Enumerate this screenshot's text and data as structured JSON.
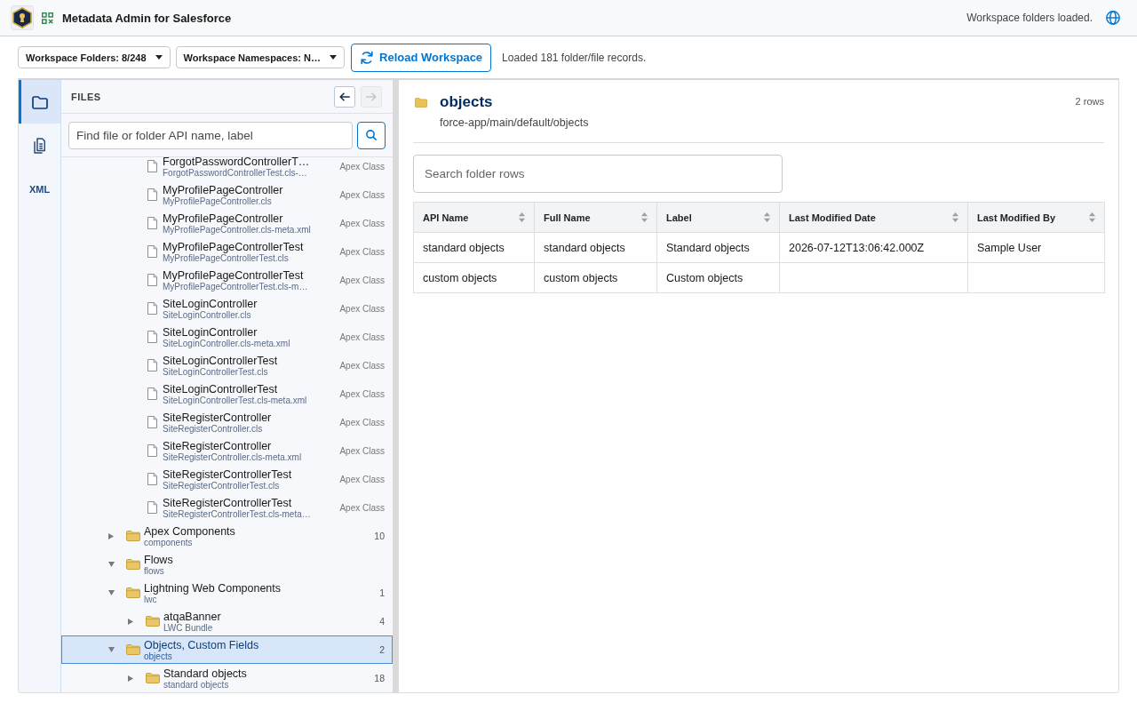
{
  "header": {
    "title": "Metadata Admin for Salesforce",
    "status": "Workspace folders loaded."
  },
  "toolbar": {
    "dropdowns": [
      {
        "label": "Workspace Folders: 8/248"
      },
      {
        "label": "Workspace Namespaces: N…"
      }
    ],
    "reload_button": {
      "label": "Reload Workspace"
    },
    "message": "Loaded 181 folder/file records."
  },
  "rail": {
    "tabs": [
      {
        "kind": "folder",
        "selected": true
      },
      {
        "kind": "document",
        "selected": false
      },
      {
        "kind": "text",
        "label": "XML",
        "selected": false
      }
    ]
  },
  "files_panel": {
    "title": "FILES",
    "nav_buttons": [
      {
        "kind": "back",
        "disabled": false
      },
      {
        "kind": "forward",
        "disabled": true
      }
    ],
    "search": {
      "placeholder": "Find file or folder API name, label"
    },
    "tree": [
      {
        "children": [
          {
            "kind": "file",
            "label": "ForgotPasswordControllerT…",
            "subtitle": "ForgotPasswordControllerTest.cls-…",
            "type": "Apex Class",
            "selected": false
          },
          {
            "kind": "file",
            "label": "MyProfilePageController",
            "subtitle": "MyProfilePageController.cls",
            "type": "Apex Class",
            "selected": false
          },
          {
            "kind": "file",
            "label": "MyProfilePageController",
            "subtitle": "MyProfilePageController.cls-meta.xml",
            "type": "Apex Class",
            "selected": false
          },
          {
            "kind": "file",
            "label": "MyProfilePageControllerTest",
            "subtitle": "MyProfilePageControllerTest.cls",
            "type": "Apex Class",
            "selected": false
          },
          {
            "kind": "file",
            "label": "MyProfilePageControllerTest",
            "subtitle": "MyProfilePageControllerTest.cls-m…",
            "type": "Apex Class",
            "selected": false
          },
          {
            "kind": "file",
            "label": "SiteLoginController",
            "subtitle": "SiteLoginController.cls",
            "type": "Apex Class",
            "selected": false
          },
          {
            "kind": "file",
            "label": "SiteLoginController",
            "subtitle": "SiteLoginController.cls-meta.xml",
            "type": "Apex Class",
            "selected": false
          },
          {
            "kind": "file",
            "label": "SiteLoginControllerTest",
            "subtitle": "SiteLoginControllerTest.cls",
            "type": "Apex Class",
            "selected": false
          },
          {
            "kind": "file",
            "label": "SiteLoginControllerTest",
            "subtitle": "SiteLoginControllerTest.cls-meta.xml",
            "type": "Apex Class",
            "selected": false
          },
          {
            "kind": "file",
            "label": "SiteRegisterController",
            "subtitle": "SiteRegisterController.cls",
            "type": "Apex Class",
            "selected": false
          },
          {
            "kind": "file",
            "label": "SiteRegisterController",
            "subtitle": "SiteRegisterController.cls-meta.xml",
            "type": "Apex Class",
            "selected": false
          },
          {
            "kind": "file",
            "label": "SiteRegisterControllerTest",
            "subtitle": "SiteRegisterControllerTest.cls",
            "type": "Apex Class",
            "selected": false
          },
          {
            "kind": "file",
            "label": "SiteRegisterControllerTest",
            "subtitle": "SiteRegisterControllerTest.cls-meta…",
            "type": "Apex Class",
            "selected": false
          }
        ]
      },
      {
        "kind": "folder",
        "label": "Apex Components",
        "subtitle": "components",
        "count": "10",
        "expanded": false,
        "selected": false
      },
      {
        "kind": "folder",
        "label": "Flows",
        "subtitle": "flows",
        "expanded": true,
        "selected": false
      },
      {
        "kind": "folder",
        "label": "Lightning Web Components",
        "subtitle": "lwc",
        "count": "1",
        "expanded": true,
        "selected": false,
        "children": [
          {
            "kind": "folder",
            "label": "atqaBanner",
            "subtitle": "LWC Bundle",
            "count": "4",
            "expanded": false,
            "selected": false
          }
        ]
      },
      {
        "kind": "folder",
        "label": "Objects, Custom Fields",
        "subtitle": "objects",
        "count": "2",
        "expanded": true,
        "selected": true,
        "children": [
          {
            "kind": "folder",
            "label": "Standard objects",
            "subtitle": "standard objects",
            "count": "18",
            "expanded": false,
            "selected": false
          }
        ]
      }
    ]
  },
  "folder_view": {
    "title": "objects",
    "path": "force-app/main/default/objects",
    "row_count": "2 rows",
    "search": {
      "placeholder": "Search folder rows"
    },
    "table": {
      "columns": [
        "API Name",
        "Full Name",
        "Label",
        "Last Modified Date",
        "Last Modified By"
      ],
      "rows": [
        [
          "standard objects",
          "standard objects",
          "Standard objects",
          "2026-07-12T13:06:42.000Z",
          "Sample User"
        ],
        [
          "custom objects",
          "custom objects",
          "Custom objects"
        ]
      ]
    }
  }
}
